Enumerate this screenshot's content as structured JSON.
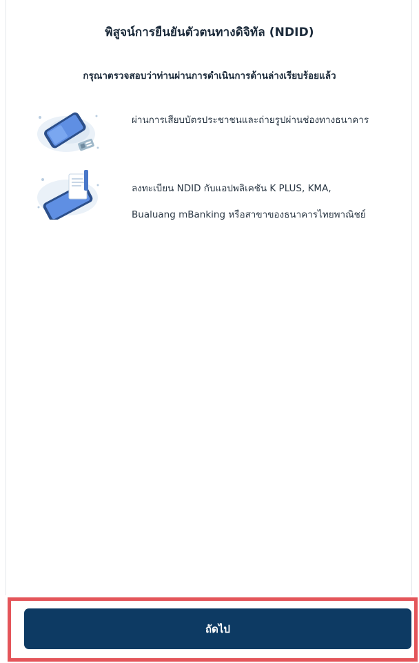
{
  "header": {
    "title": "พิสูจน์การยืนยันตัวตนทางดิจิทัล (NDID)",
    "subtitle": "กรุณาตรวจสอบว่าท่านผ่านการดำเนินการด้านล่างเรียบร้อยแล้ว"
  },
  "steps": [
    {
      "icon": "phone-id-card-icon",
      "text": "ผ่านการเสียบบัตรประชาชนและถ่ายรูปผ่านช่องทางธนาคาร"
    },
    {
      "icon": "phone-document-icon",
      "line1": "ลงทะเบียน NDID กับแอปพลิเคชัน K PLUS, KMA,",
      "line2": "Bualuang mBanking หรือสาขาของธนาคารไทยพาณิชย์"
    }
  ],
  "footer": {
    "next_label": "ถัดไป"
  },
  "colors": {
    "primary_button": "#0d3a63",
    "highlight": "#e4555a"
  }
}
